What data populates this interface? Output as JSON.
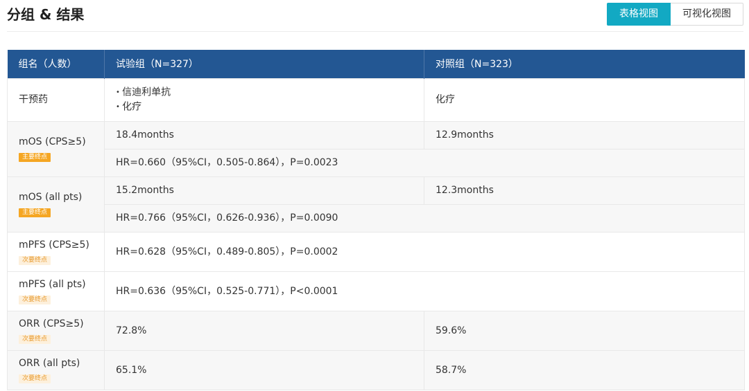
{
  "page": {
    "title": "分组 & 结果",
    "view_buttons": [
      "表格视图",
      "可视化视图"
    ],
    "active_view": "表格视图"
  },
  "table": {
    "headers": [
      "组名（人数）",
      "试验组（N=327）",
      "对照组（N=323）"
    ],
    "intervention": {
      "label": "干预药",
      "trial": [
        "信迪利单抗",
        "化疗"
      ],
      "control": "化疗"
    },
    "mos_cps": {
      "label": "mOS (CPS≥5)",
      "badge": "主要终点",
      "trial": "18.4months",
      "control": "12.9months",
      "hr": "HR=0.660（95%CI，0.505-0.864），P=0.0023"
    },
    "mos_all": {
      "label": "mOS (all pts)",
      "badge": "主要终点",
      "trial": "15.2months",
      "control": "12.3months",
      "hr": "HR=0.766（95%CI，0.626-0.936），P=0.0090"
    },
    "mpfs_cps": {
      "label": "mPFS (CPS≥5)",
      "badge": "次要终点",
      "hr": "HR=0.628（95%CI，0.489-0.805），P=0.0002"
    },
    "mpfs_all": {
      "label": "mPFS (all pts)",
      "badge": "次要终点",
      "hr": "HR=0.636（95%CI，0.525-0.771），P<0.0001"
    },
    "orr_cps": {
      "label": "ORR (CPS≥5)",
      "badge": "次要终点",
      "trial": "72.8%",
      "control": "59.6%"
    },
    "orr_all": {
      "label": "ORR (all pts)",
      "badge": "次要终点",
      "trial": "65.1%",
      "control": "58.7%"
    }
  },
  "colors": {
    "header_bg": "#235793",
    "active_button": "#12a9c3",
    "primary_badge": "#f5a623",
    "secondary_badge_bg": "#fdf0dc",
    "secondary_badge_text": "#e89a2e"
  }
}
